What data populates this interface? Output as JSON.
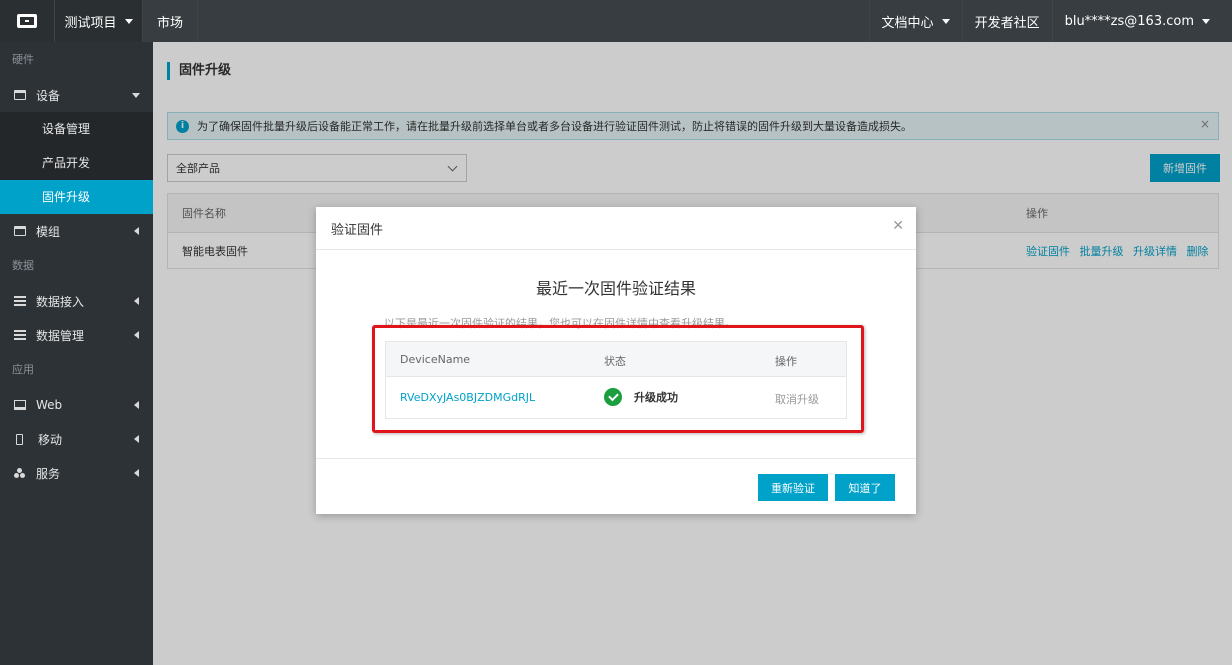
{
  "topbar": {
    "project": "测试项目",
    "market": "市场",
    "docs": "文档中心",
    "community": "开发者社区",
    "user": "blu****zs@163.com"
  },
  "sidebar": {
    "group_hardware": "硬件",
    "device": "设备",
    "device_manage": "设备管理",
    "product_dev": "产品开发",
    "firmware_upgrade": "固件升级",
    "module": "模组",
    "group_data": "数据",
    "data_access": "数据接入",
    "data_manage": "数据管理",
    "group_app": "应用",
    "web": "Web",
    "mobile": "移动",
    "service": "服务"
  },
  "main": {
    "title": "固件升级",
    "notice": "为了确保固件批量升级后设备能正常工作，请在批量升级前选择单台或者多台设备进行验证固件测试，防止将错误的固件升级到大量设备造成损失。",
    "product_select": "全部产品",
    "add_button": "新增固件",
    "table": {
      "col_name": "固件名称",
      "col_ops": "操作",
      "row_name": "智能电表固件",
      "ops": [
        "验证固件",
        "批量升级",
        "升级详情",
        "删除"
      ]
    }
  },
  "modal": {
    "title": "验证固件",
    "heading": "最近一次固件验证结果",
    "desc": "以下是最近一次固件验证的结果，您也可以在固件详情中查看升级结果。",
    "table": {
      "col_device": "DeviceName",
      "col_status": "状态",
      "col_ops": "操作",
      "device": "RVeDXyJAs0BJZDMGdRJL",
      "status": "升级成功",
      "op": "取消升级"
    },
    "reverify_button": "重新验证",
    "ok_button": "知道了"
  },
  "colors": {
    "accent": "#00a2ca",
    "success": "#1a9e3e",
    "highlight_frame": "#e0151b"
  }
}
